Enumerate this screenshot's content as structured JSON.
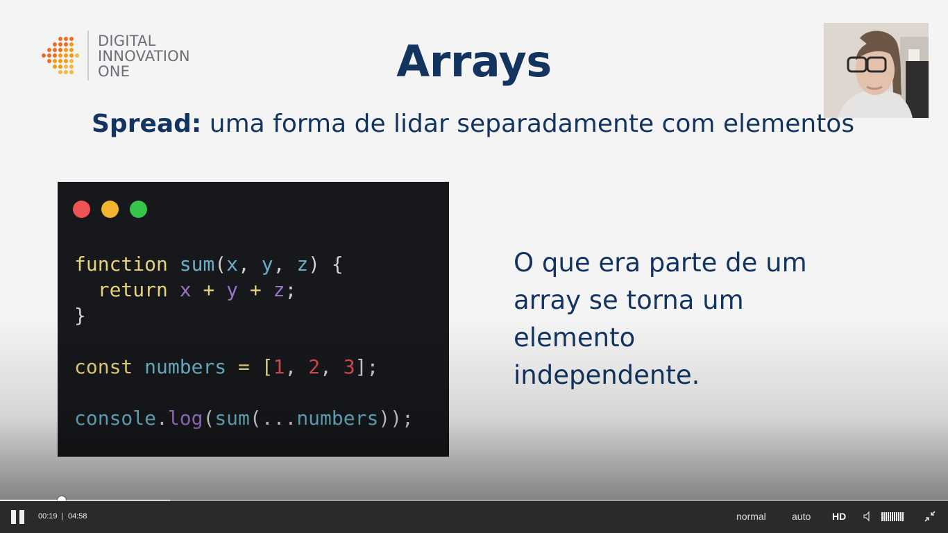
{
  "brand": {
    "line1": "DIGITAL",
    "line2": "INNOVATION",
    "line3": "ONE",
    "icon": "dio-logo-icon"
  },
  "slide": {
    "title": "Arrays",
    "subtitle_bold": "Spread:",
    "subtitle_rest": " uma forma de lidar separadamente com elementos",
    "description_lines": [
      "O que era parte de um",
      "array se torna um",
      "elemento",
      "independente."
    ]
  },
  "code_panel": {
    "window_dots": [
      "#ed5353",
      "#f1b42f",
      "#36c44b"
    ],
    "tokens": {
      "l1_kw": "function",
      "l1_fn": "sum",
      "l1_p1": "(",
      "l1_x": "x",
      "l1_p2": ", ",
      "l1_y": "y",
      "l1_p3": ", ",
      "l1_z": "z",
      "l1_p4": ") {",
      "l2_indent": "  ",
      "l2_kw": "return",
      "l2_sp": " ",
      "l2_x": "x",
      "l2_op1": " + ",
      "l2_y": "y",
      "l2_op2": " + ",
      "l2_z": "z",
      "l2_end": ";",
      "l3": "}",
      "l5_kw": "const",
      "l5_fn": "numbers",
      "l5_eq": " = [",
      "l5_n1": "1",
      "l5_c1": ", ",
      "l5_n2": "2",
      "l5_c2": ", ",
      "l5_n3": "3",
      "l5_end": "];",
      "l7_fn1": "console",
      "l7_dot": ".",
      "l7_log": "log",
      "l7_p1": "(",
      "l7_fn2": "sum",
      "l7_p2": "(...",
      "l7_fn3": "numbers",
      "l7_p3": "));"
    }
  },
  "player": {
    "current_time": "00:19",
    "separator": "|",
    "duration": "04:58",
    "played_fraction": 0.065,
    "buffered_fraction": 0.179,
    "speed_label": "normal",
    "quality_mode_label": "auto",
    "hd_label": "HD",
    "volume_bars": 11,
    "pause_icon": "pause-icon",
    "volume_icon": "volume-icon",
    "fullscreen_icon": "exit-fullscreen-icon"
  }
}
